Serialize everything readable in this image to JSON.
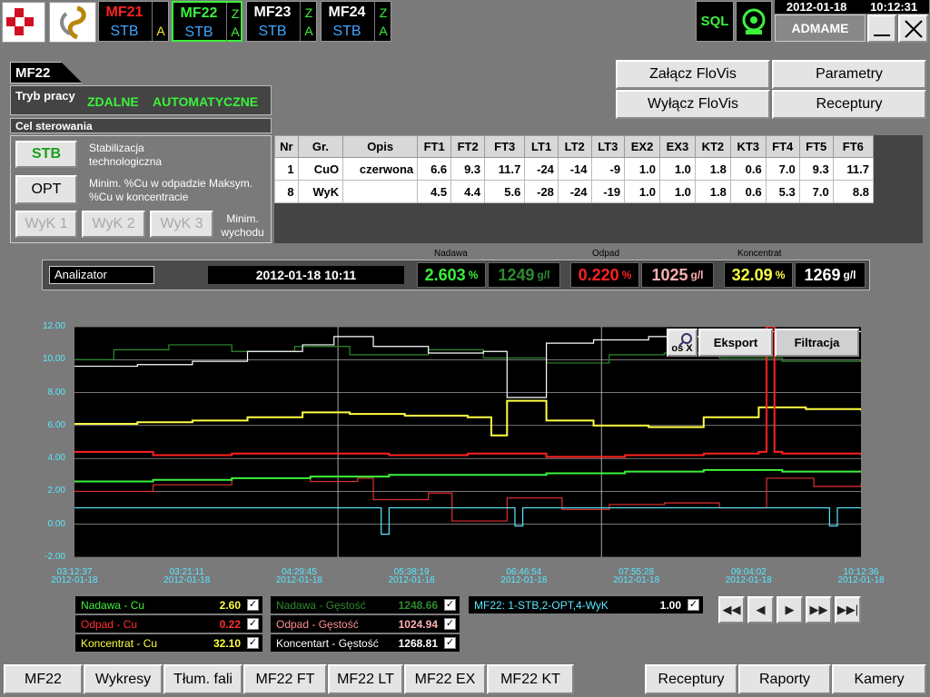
{
  "header": {
    "date": "2012-01-18",
    "time": "10:12:31",
    "user": "ADMAME",
    "sql": "SQL"
  },
  "tiles": [
    {
      "name": "MF21",
      "state": "STB",
      "z": "",
      "a": "A",
      "name_color": "#ff2222",
      "a_color": "#ffe83a"
    },
    {
      "name": "MF22",
      "state": "STB",
      "z": "Z",
      "a": "A",
      "name_color": "#3cf23c",
      "a_color": "#3cf23c"
    },
    {
      "name": "MF23",
      "state": "STB",
      "z": "Z",
      "a": "A",
      "name_color": "#ffffff",
      "a_color": "#3cf23c"
    },
    {
      "name": "MF24",
      "state": "STB",
      "z": "Z",
      "a": "A",
      "name_color": "#ffffff",
      "a_color": "#3cf23c"
    }
  ],
  "section": {
    "title": "MF22",
    "mode_label": "Tryb pracy",
    "mode_remote": "ZDALNE",
    "mode_auto": "AUTOMATYCZNE",
    "goal_label": "Cel sterowania",
    "stb": "STB",
    "stb_desc": "Stabilizacja technologiczna",
    "opt": "OPT",
    "opt_desc": "Minim. %Cu w odpadzie Maksym. %Cu w koncentracie",
    "wyk1": "WyK 1",
    "wyk2": "WyK 2",
    "wyk3": "WyK 3",
    "wyk_desc": "Minim. wychodu"
  },
  "actions": {
    "floviz_on": "Załącz FloVis",
    "floviz_off": "Wyłącz FloVis",
    "params": "Parametry",
    "recipes": "Receptury"
  },
  "table": {
    "headers": [
      "Nr",
      "Gr.",
      "Opis",
      "FT1",
      "FT2",
      "FT3",
      "LT1",
      "LT2",
      "LT3",
      "EX2",
      "EX3",
      "KT2",
      "KT3",
      "FT4",
      "FT5",
      "FT6"
    ],
    "rows": [
      [
        "1",
        "CuO",
        "czerwona",
        "6.6",
        "9.3",
        "11.7",
        "-24",
        "-14",
        "-9",
        "1.0",
        "1.0",
        "1.8",
        "0.6",
        "7.0",
        "9.3",
        "11.7"
      ],
      [
        "8",
        "WyK",
        "",
        "4.5",
        "4.4",
        "5.6",
        "-28",
        "-24",
        "-19",
        "1.0",
        "1.0",
        "1.8",
        "0.6",
        "5.3",
        "7.0",
        "8.8"
      ]
    ]
  },
  "analyzer": {
    "label": "Analizator",
    "timestamp": "2012-01-18 10:11",
    "feed_label": "Nadawa",
    "feed_pct": "2.603",
    "feed_density": "1249",
    "tail_label": "Odpad",
    "tail_pct": "0.220",
    "tail_density": "1025",
    "conc_label": "Koncentrat",
    "conc_pct": "32.09",
    "conc_density": "1269",
    "pct_unit": "%",
    "density_unit": "g/l"
  },
  "chart_buttons": {
    "axis": "oś X",
    "export": "Eksport",
    "filter": "Filtracja"
  },
  "chart_data": {
    "type": "line",
    "y_ticks": [
      "12.00",
      "10.00",
      "8.00",
      "6.00",
      "4.00",
      "2.00",
      "0.00",
      "-2.00"
    ],
    "ylim": [
      -2,
      12
    ],
    "x_ticks": [
      {
        "t": "03:12:37",
        "d": "2012-01-18"
      },
      {
        "t": "03:21:11",
        "d": "2012-01-18"
      },
      {
        "t": "04:29:45",
        "d": "2012-01-18"
      },
      {
        "t": "05:38:19",
        "d": "2012-01-18"
      },
      {
        "t": "06:46:54",
        "d": "2012-01-18"
      },
      {
        "t": "07:55:28",
        "d": "2012-01-18"
      },
      {
        "t": "09:04:02",
        "d": "2012-01-18"
      },
      {
        "t": "10:12:36",
        "d": "2012-01-18"
      }
    ],
    "series": [
      {
        "name": "Nadawa - Gęstość",
        "color": "#2f8a2f",
        "x": [
          0,
          0.05,
          0.12,
          0.2,
          0.28,
          0.35,
          0.45,
          0.52,
          0.6,
          0.68,
          0.75,
          0.82,
          0.9,
          1
        ],
        "y": [
          10.0,
          10.6,
          10.9,
          10.5,
          10.8,
          10.3,
          10.6,
          10.1,
          9.8,
          10.3,
          10.4,
          10.1,
          9.9,
          10.0
        ]
      },
      {
        "name": "Koncentrat - Gęstość",
        "color": "#ffffff",
        "x": [
          0,
          0.08,
          0.15,
          0.22,
          0.29,
          0.33,
          0.38,
          0.45,
          0.52,
          0.55,
          0.6,
          0.66,
          0.73,
          0.8,
          0.87,
          0.93,
          1
        ],
        "y": [
          9.6,
          9.7,
          9.9,
          10.5,
          10.9,
          11.4,
          10.8,
          10.4,
          10.5,
          7.7,
          11.0,
          11.2,
          11.4,
          11.5,
          11.7,
          11.7,
          11.7
        ]
      },
      {
        "name": "Koncentrat - Cu",
        "color": "#ffff44",
        "x": [
          0,
          0.08,
          0.15,
          0.22,
          0.29,
          0.35,
          0.42,
          0.5,
          0.53,
          0.55,
          0.6,
          0.66,
          0.73,
          0.8,
          0.87,
          0.93,
          1
        ],
        "y": [
          6.1,
          6.2,
          6.3,
          6.5,
          6.8,
          6.7,
          6.6,
          6.5,
          5.4,
          7.5,
          6.3,
          6.0,
          5.9,
          6.5,
          7.1,
          7.0,
          6.9
        ]
      },
      {
        "name": "Odpad - Gęstość",
        "color": "#e03030",
        "x": [
          0,
          0.1,
          0.2,
          0.3,
          0.36,
          0.38,
          0.45,
          0.48,
          0.55,
          0.62,
          0.68,
          0.75,
          0.82,
          0.88,
          0.94,
          1
        ],
        "y": [
          2.0,
          2.4,
          2.8,
          2.6,
          2.8,
          1.5,
          1.9,
          0.2,
          1.6,
          0.9,
          1.2,
          1.3,
          1.0,
          2.8,
          2.3,
          2.5
        ]
      },
      {
        "name": "Odpad - Cu",
        "color": "#ff2020",
        "x": [
          0,
          0.1,
          0.2,
          0.3,
          0.4,
          0.5,
          0.6,
          0.7,
          0.8,
          0.87,
          0.88,
          0.89,
          0.9,
          1
        ],
        "y": [
          4.4,
          4.2,
          4.3,
          4.3,
          4.2,
          4.3,
          4.1,
          4.2,
          4.3,
          4.4,
          12.0,
          4.4,
          4.3,
          4.2
        ]
      },
      {
        "name": "Nadawa - Cu",
        "color": "#3cf23c",
        "x": [
          0,
          0.1,
          0.2,
          0.3,
          0.4,
          0.5,
          0.6,
          0.7,
          0.8,
          0.9,
          1
        ],
        "y": [
          2.6,
          2.7,
          2.8,
          2.9,
          3.0,
          3.0,
          3.1,
          3.2,
          3.3,
          3.2,
          3.2
        ]
      },
      {
        "name": "MF22: 1-STB,2-OPT,4-WyK",
        "color": "#59e8ff",
        "x": [
          0,
          0.38,
          0.39,
          0.4,
          0.55,
          0.56,
          0.57,
          0.95,
          0.96,
          0.97,
          1
        ],
        "y": [
          1.0,
          1.0,
          -0.6,
          1.0,
          1.0,
          -0.1,
          1.0,
          1.0,
          -0.1,
          1.0,
          1.0
        ]
      }
    ]
  },
  "legend": [
    {
      "label": "Nadawa - Cu",
      "value": "2.60",
      "color": "#3cf23c",
      "vcolor": "#ffff44"
    },
    {
      "label": "Odpad - Cu",
      "value": "0.22",
      "color": "#ff3030",
      "vcolor": "#ff3030"
    },
    {
      "label": "Koncentrat - Cu",
      "value": "32.10",
      "color": "#ffff44",
      "vcolor": "#ffff44"
    },
    {
      "label": "Nadawa - Gęstość",
      "value": "1248.66",
      "color": "#2f8a2f",
      "vcolor": "#2f8a2f"
    },
    {
      "label": "Odpad - Gęstość",
      "value": "1024.94",
      "color": "#ff9090",
      "vcolor": "#ffb0b0"
    },
    {
      "label": "Koncentart - Gęstość",
      "value": "1268.81",
      "color": "#ffffff",
      "vcolor": "#ffffff"
    },
    {
      "label": "MF22: 1-STB,2-OPT,4-WyK",
      "value": "1.00",
      "color": "#59e8ff",
      "vcolor": "#ffffff"
    }
  ],
  "bottom": [
    "MF22",
    "Wykresy",
    "Tłum. fali",
    "MF22 FT",
    "MF22 LT",
    "MF22 EX",
    "MF22 KT",
    "Receptury",
    "Raporty",
    "Kamery"
  ],
  "check": "✓"
}
